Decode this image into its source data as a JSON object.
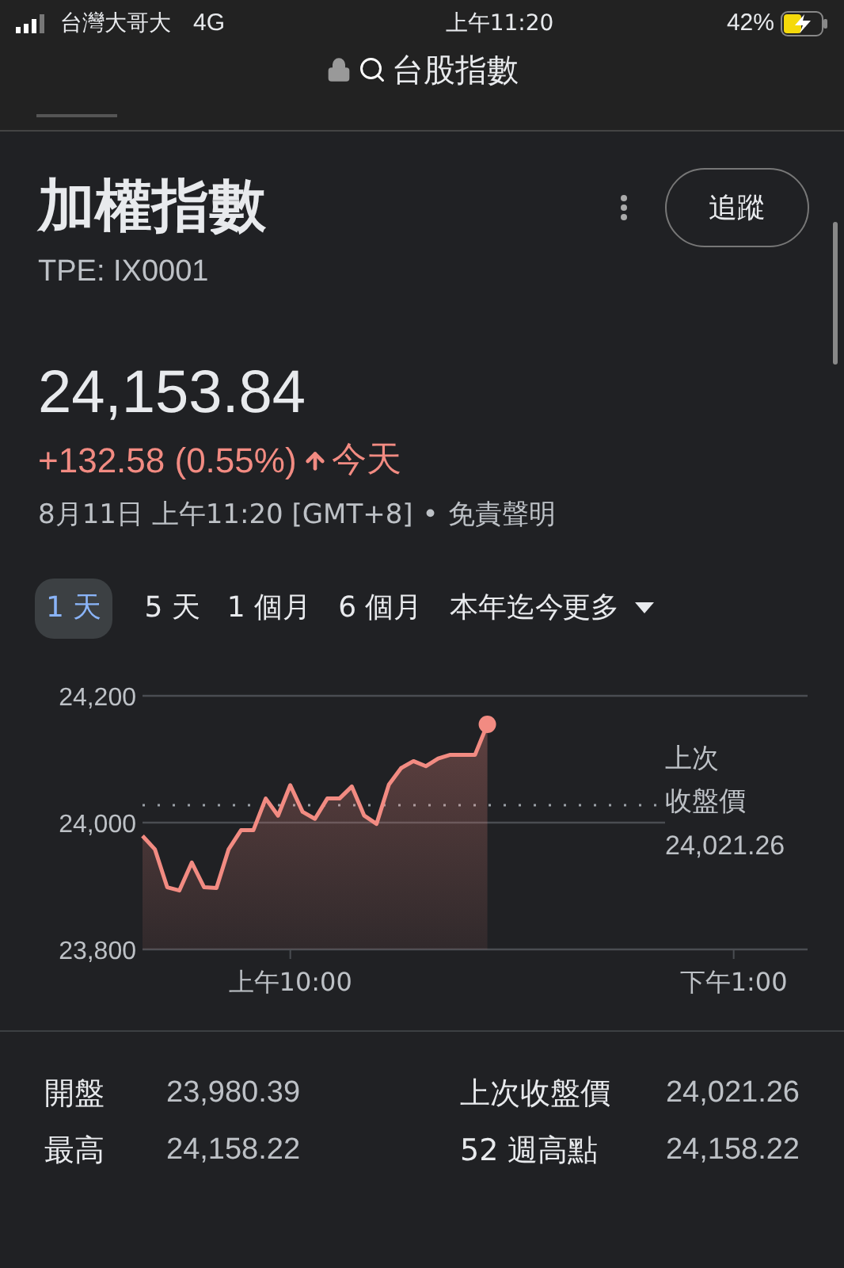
{
  "status_bar": {
    "carrier": "台灣大哥大",
    "network": "4G",
    "time": "上午11:20",
    "battery": "42%"
  },
  "address_bar": {
    "query": "台股指數"
  },
  "header": {
    "title": "加權指數",
    "ticker": "TPE: IX0001",
    "follow_button": "追蹤"
  },
  "quote": {
    "price": "24,153.84",
    "change": "+132.58 (0.55%)",
    "period": "今天",
    "timestamp": "8月11日 上午11:20 [GMT+8]",
    "separator": "•",
    "disclaimer": "免責聲明"
  },
  "ranges": [
    {
      "label": "1 天",
      "selected": true
    },
    {
      "label": "5 天",
      "selected": false
    },
    {
      "label": "1 個月",
      "selected": false
    },
    {
      "label": "6 個月",
      "selected": false
    },
    {
      "label": "本年迄今",
      "selected": false
    }
  ],
  "more_button": "更多",
  "chart": {
    "previous_close_label": [
      "上次",
      "收盤價"
    ],
    "previous_close_value": "24,021.26",
    "chart_data": {
      "type": "line",
      "categories": [
        null,
        null,
        null,
        null,
        null,
        null,
        null,
        null,
        null,
        null,
        null,
        null,
        "上午10:00",
        null,
        null,
        null,
        null,
        null,
        null,
        null,
        null,
        null,
        null,
        null,
        null,
        null,
        null,
        null,
        null,
        null,
        null,
        null,
        null,
        null,
        null,
        null,
        null,
        null,
        null,
        null,
        null,
        null,
        null,
        null,
        null,
        null,
        null,
        null,
        "下午1:00",
        null,
        null,
        null,
        null,
        null,
        null
      ],
      "series": [
        {
          "color": "#f28b82",
          "values": [
            23979,
            23958,
            23898,
            23893,
            23937,
            23898,
            23897,
            23958,
            23988,
            23988,
            24038,
            24011,
            24059,
            24017,
            24006,
            24038,
            24038,
            24057,
            24011,
            23998,
            24060,
            24086,
            24097,
            24089,
            24101,
            24107,
            24107,
            24107,
            24155,
            null,
            null,
            null,
            null,
            null,
            null,
            null,
            null,
            null,
            null,
            null,
            null,
            null,
            null,
            null,
            null,
            null,
            null,
            null,
            null,
            null,
            null,
            null,
            null,
            null,
            null
          ]
        }
      ],
      "ylim": [
        23800,
        24200
      ],
      "yticks": [
        {
          "value": 23800,
          "label": "23,800"
        },
        {
          "value": 24000,
          "label": "24,000"
        },
        {
          "value": 24200,
          "label": "24,200"
        }
      ]
    }
  },
  "stats": [
    {
      "label": "開盤",
      "value": "23,980.39"
    },
    {
      "label": "上次收盤價",
      "value": "24,021.26"
    },
    {
      "label": "最高",
      "value": "24,158.22"
    },
    {
      "label": "52 週高點",
      "value": "24,158.22"
    }
  ]
}
